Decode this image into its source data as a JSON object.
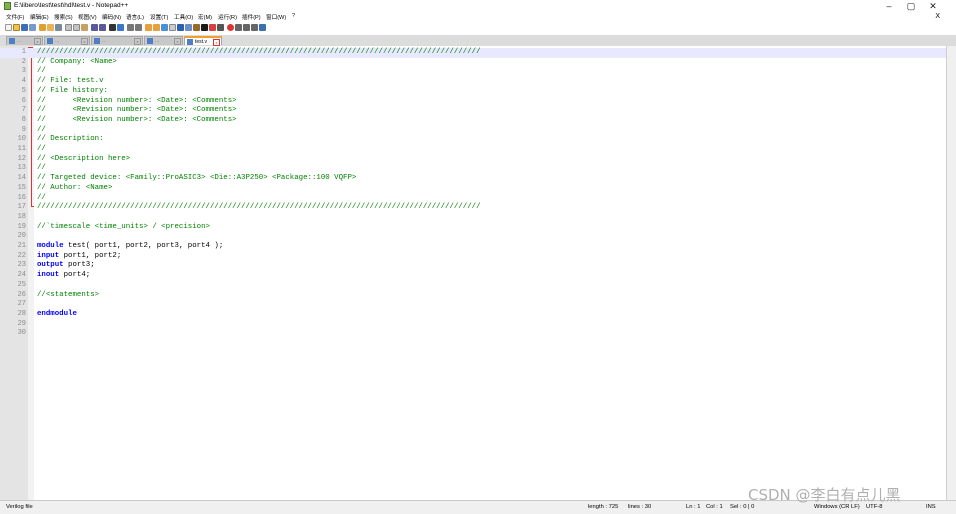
{
  "window": {
    "title": "E:\\libero\\test\\test\\hdl\\test.v - Notepad++",
    "minimize": "–",
    "maximize": "▢",
    "close": "✕",
    "doc_close": "X"
  },
  "menu": {
    "items": [
      "文件(F)",
      "编辑(E)",
      "搜索(S)",
      "视图(V)",
      "编码(N)",
      "语言(L)",
      "设置(T)",
      "工具(O)",
      "宏(M)",
      "运行(R)",
      "插件(P)",
      "窗口(W)",
      "?"
    ]
  },
  "tabs": [
    {
      "label": "..."
    },
    {
      "label": "..."
    },
    {
      "label": "..."
    },
    {
      "label": "..."
    },
    {
      "label": "test.v",
      "active": true
    }
  ],
  "editor": {
    "current_line": 1,
    "lines": [
      {
        "n": "1",
        "segs": [
          {
            "t": "////////////////////////////////////////////////////////////////////////////////////////////////////",
            "c": "cm"
          }
        ]
      },
      {
        "n": "2",
        "segs": [
          {
            "t": "// Company: <Name>",
            "c": "cm"
          }
        ]
      },
      {
        "n": "3",
        "segs": [
          {
            "t": "//",
            "c": "cm"
          }
        ]
      },
      {
        "n": "4",
        "segs": [
          {
            "t": "// File: test.v",
            "c": "cm"
          }
        ]
      },
      {
        "n": "5",
        "segs": [
          {
            "t": "// File history:",
            "c": "cm"
          }
        ]
      },
      {
        "n": "6",
        "segs": [
          {
            "t": "//      <Revision number>: <Date>: <Comments>",
            "c": "cm"
          }
        ]
      },
      {
        "n": "7",
        "segs": [
          {
            "t": "//      <Revision number>: <Date>: <Comments>",
            "c": "cm"
          }
        ]
      },
      {
        "n": "8",
        "segs": [
          {
            "t": "//      <Revision number>: <Date>: <Comments>",
            "c": "cm"
          }
        ]
      },
      {
        "n": "9",
        "segs": [
          {
            "t": "//",
            "c": "cm"
          }
        ]
      },
      {
        "n": "10",
        "segs": [
          {
            "t": "// Description:",
            "c": "cm"
          }
        ]
      },
      {
        "n": "11",
        "segs": [
          {
            "t": "//",
            "c": "cm"
          }
        ]
      },
      {
        "n": "12",
        "segs": [
          {
            "t": "// <Description here>",
            "c": "cm"
          }
        ]
      },
      {
        "n": "13",
        "segs": [
          {
            "t": "//",
            "c": "cm"
          }
        ]
      },
      {
        "n": "14",
        "segs": [
          {
            "t": "// Targeted device: <Family::ProASIC3> <Die::A3P250> <Package::100 VQFP>",
            "c": "cm"
          }
        ]
      },
      {
        "n": "15",
        "segs": [
          {
            "t": "// Author: <Name>",
            "c": "cm"
          }
        ]
      },
      {
        "n": "16",
        "segs": [
          {
            "t": "//",
            "c": "cm"
          }
        ]
      },
      {
        "n": "17",
        "segs": [
          {
            "t": "////////////////////////////////////////////////////////////////////////////////////////////////////",
            "c": "cm"
          }
        ]
      },
      {
        "n": "18",
        "segs": []
      },
      {
        "n": "19",
        "segs": [
          {
            "t": "//`timescale <time_units> / <precision>",
            "c": "cm"
          }
        ]
      },
      {
        "n": "20",
        "segs": []
      },
      {
        "n": "21",
        "segs": [
          {
            "t": "module",
            "c": "kw"
          },
          {
            "t": " test( port1, port2, port3, port4 );",
            "c": "tx"
          }
        ]
      },
      {
        "n": "22",
        "segs": [
          {
            "t": "input",
            "c": "kw"
          },
          {
            "t": " port1, port2;",
            "c": "tx"
          }
        ]
      },
      {
        "n": "23",
        "segs": [
          {
            "t": "output",
            "c": "kw"
          },
          {
            "t": " port3;",
            "c": "tx"
          }
        ]
      },
      {
        "n": "24",
        "segs": [
          {
            "t": "inout",
            "c": "kw"
          },
          {
            "t": " port4;",
            "c": "tx"
          }
        ]
      },
      {
        "n": "25",
        "segs": []
      },
      {
        "n": "26",
        "segs": [
          {
            "t": "//<statements>",
            "c": "cm"
          }
        ]
      },
      {
        "n": "27",
        "segs": []
      },
      {
        "n": "28",
        "segs": [
          {
            "t": "endmodule",
            "c": "kw"
          }
        ]
      },
      {
        "n": "29",
        "segs": []
      },
      {
        "n": "30",
        "segs": []
      }
    ]
  },
  "status": {
    "language": "Verilog file",
    "length": "length : 725",
    "lines": "lines : 30",
    "ln": "Ln : 1",
    "col": "Col : 1",
    "sel": "Sel : 0 | 0",
    "eol": "Windows (CR LF)",
    "encoding": "UTF-8",
    "mode": "INS"
  },
  "watermark": "CSDN @李白有点儿黑",
  "colors": {
    "comment": "#008000",
    "keyword": "#0000ff",
    "current_line": "#e8e8ff",
    "gutter": "#e4e4e4"
  }
}
